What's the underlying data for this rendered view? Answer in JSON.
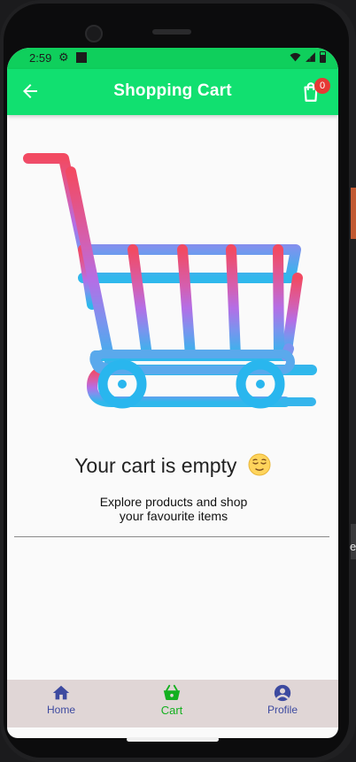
{
  "status_bar": {
    "time": "2:59",
    "icons": [
      "gear-icon",
      "square-icon",
      "wifi-icon",
      "signal-icon",
      "battery-icon"
    ]
  },
  "app_bar": {
    "title": "Shopping Cart",
    "back_icon": "arrow-left-icon",
    "cart_icon": "shopping-bag-icon",
    "cart_badge": "0"
  },
  "empty_state": {
    "title": "Your cart is empty",
    "emoji": "relieved-face-icon",
    "subtitle": "Explore products and shop your favourite items"
  },
  "bottom_nav": {
    "items": [
      {
        "label": "Home",
        "icon": "home-icon",
        "active": false
      },
      {
        "label": "Cart",
        "icon": "basket-icon",
        "active": true
      },
      {
        "label": "Profile",
        "icon": "account-circle-icon",
        "active": false
      }
    ]
  },
  "offscreen_text": "e",
  "colors": {
    "app_bar": "#11e070",
    "status_bar": "#0fcf5c",
    "badge": "#e53935",
    "nav_active": "#13b01f",
    "nav_inactive": "#3d4aa0",
    "nav_background": "#e0d6d6"
  }
}
